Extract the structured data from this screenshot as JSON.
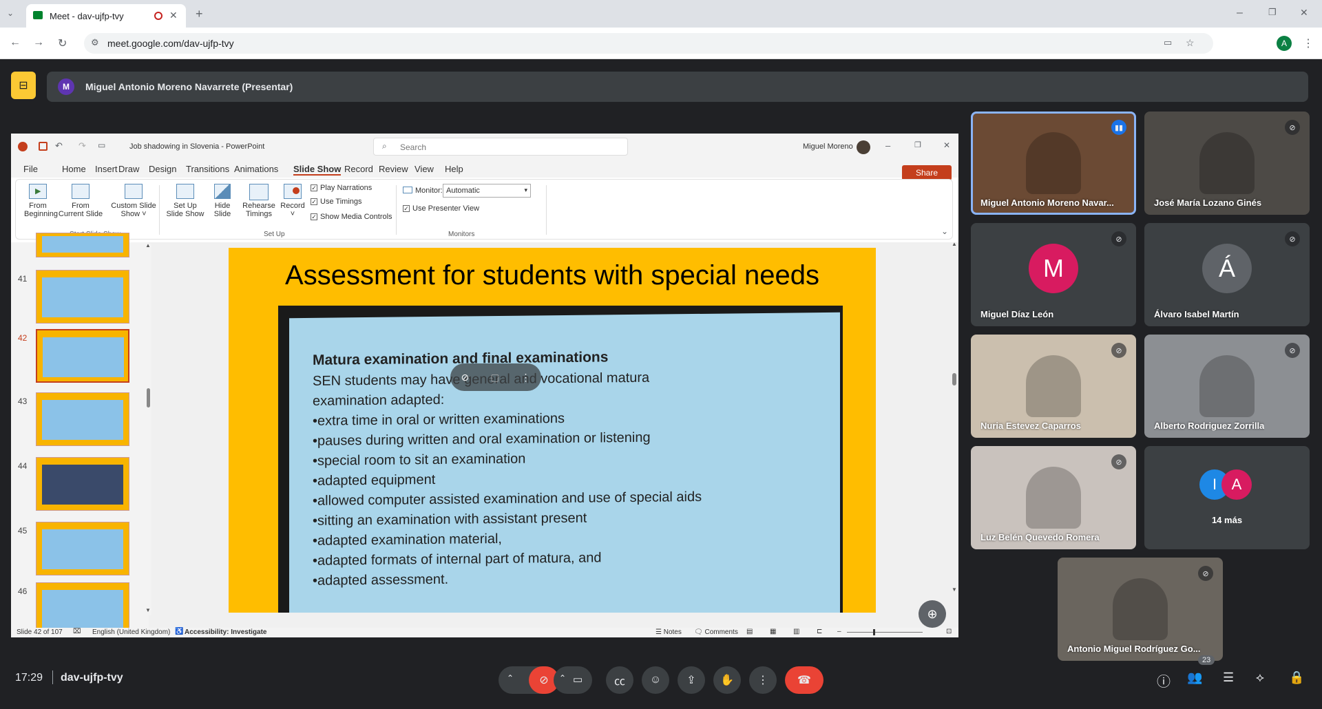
{
  "browser": {
    "tab_title": "Meet - dav-ujfp-tvy",
    "url": "meet.google.com/dav-ujfp-tvy",
    "profile_initial": "A"
  },
  "meet": {
    "presenter_banner": "Miguel Antonio Moreno Navarrete (Presentar)",
    "presenter_initial": "M",
    "time": "17:29",
    "meeting_code": "dav-ujfp-tvy",
    "participants_count": "23",
    "more_label": "14 más",
    "more_initials": [
      "I",
      "A"
    ],
    "participants": [
      {
        "name": "Miguel Antonio Moreno Navar...",
        "kind": "video",
        "speaking": true
      },
      {
        "name": "José María Lozano Ginés",
        "kind": "video",
        "muted": true
      },
      {
        "name": "Miguel Díaz León",
        "kind": "avatar",
        "initial": "M",
        "color": "#d81b60",
        "muted": true
      },
      {
        "name": "Álvaro Isabel Martín",
        "kind": "avatar",
        "initial": "Á",
        "color": "#5f6368",
        "muted": true
      },
      {
        "name": "Nuria Estevez Caparros",
        "kind": "video",
        "muted": true
      },
      {
        "name": "Alberto Rodriguez Zorrilla",
        "kind": "video",
        "muted": true
      },
      {
        "name": "Luz Belén Quevedo Romera",
        "kind": "video",
        "muted": true
      },
      {
        "name": "Antonio Miguel Rodríguez Go...",
        "kind": "video",
        "muted": true
      }
    ]
  },
  "ppt": {
    "doc_title": "Job shadowing in Slovenia - PowerPoint",
    "search_placeholder": "Search",
    "user": "Miguel Moreno",
    "menu": [
      "File",
      "Home",
      "Insert",
      "Draw",
      "Design",
      "Transitions",
      "Animations",
      "Slide Show",
      "Record",
      "Review",
      "View",
      "Help"
    ],
    "active_menu": "Slide Show",
    "share_label": "Share",
    "ribbon": {
      "from_beginning": [
        "From",
        "Beginning"
      ],
      "from_current": [
        "From",
        "Current Slide"
      ],
      "custom_show": [
        "Custom Slide",
        "Show ˅"
      ],
      "group_start": "Start Slide Show",
      "setup_show": [
        "Set Up",
        "Slide Show"
      ],
      "hide_slide": [
        "Hide",
        "Slide"
      ],
      "rehearse": [
        "Rehearse",
        "Timings"
      ],
      "record": [
        "Record",
        "˅"
      ],
      "play_narrations": "Play Narrations",
      "use_timings": "Use Timings",
      "show_media": "Show Media Controls",
      "group_setup": "Set Up",
      "monitor_label": "Monitor:",
      "monitor_value": "Automatic",
      "presenter_view": "Use Presenter View",
      "group_monitors": "Monitors"
    },
    "thumb_numbers": [
      "41",
      "42",
      "43",
      "44",
      "45",
      "46"
    ],
    "slide_title": "Assessment for students with special needs",
    "slide_heading": "Matura examination and final examinations",
    "slide_lines": [
      "SEN students may have general and vocational matura",
      "examination adapted:",
      "•extra time in oral or written examinations",
      "•pauses during written and oral examination or listening",
      "•special room to sit an examination",
      "•adapted equipment",
      "•allowed computer assisted examination and use of special aids",
      "•sitting an examination with assistant present",
      "•adapted examination material,",
      "•adapted formats of internal part of matura, and",
      "•adapted assessment."
    ],
    "status": {
      "slide_of": "Slide 42 of 107",
      "language": "English (United Kingdom)",
      "accessibility": "Accessibility: Investigate",
      "notes": "Notes",
      "comments": "Comments"
    }
  }
}
